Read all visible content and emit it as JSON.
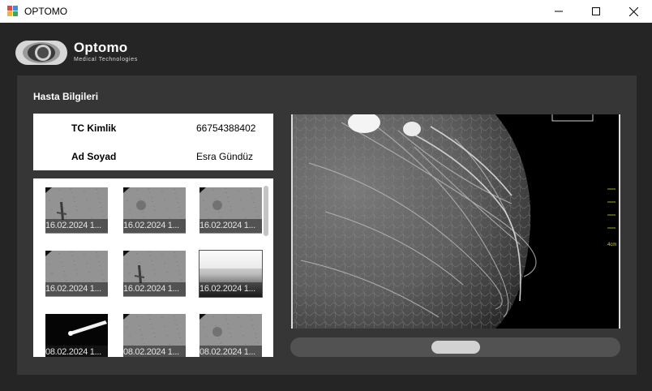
{
  "window": {
    "title": "OPTOMO"
  },
  "brand": {
    "name": "Optomo",
    "subtitle": "Medical Technologies"
  },
  "patient": {
    "section_title": "Hasta Bilgileri",
    "fields": [
      {
        "label": "TC Kimlik",
        "value": "66754388402"
      },
      {
        "label": "Ad Soyad",
        "value": "Esra Gündüz"
      }
    ]
  },
  "thumbnails": [
    {
      "date": "16.02.2024 1...",
      "style": "gray-mark"
    },
    {
      "date": "16.02.2024 1...",
      "style": "gray-dot"
    },
    {
      "date": "16.02.2024 1...",
      "style": "gray-dot"
    },
    {
      "date": "16.02.2024 1...",
      "style": "gray-plain"
    },
    {
      "date": "16.02.2024 1...",
      "style": "gray-mark"
    },
    {
      "date": "16.02.2024 1...",
      "style": "gradient-selected"
    },
    {
      "date": "08.02.2024 1...",
      "style": "dark-needle"
    },
    {
      "date": "08.02.2024 1...",
      "style": "gray-plain"
    },
    {
      "date": "08.02.2024 1...",
      "style": "gray-dot"
    }
  ],
  "viewer": {
    "scale_label": "4cm"
  },
  "colors": {
    "background": "#252525",
    "panel": "#363636",
    "scale_color": "#d8d800"
  }
}
